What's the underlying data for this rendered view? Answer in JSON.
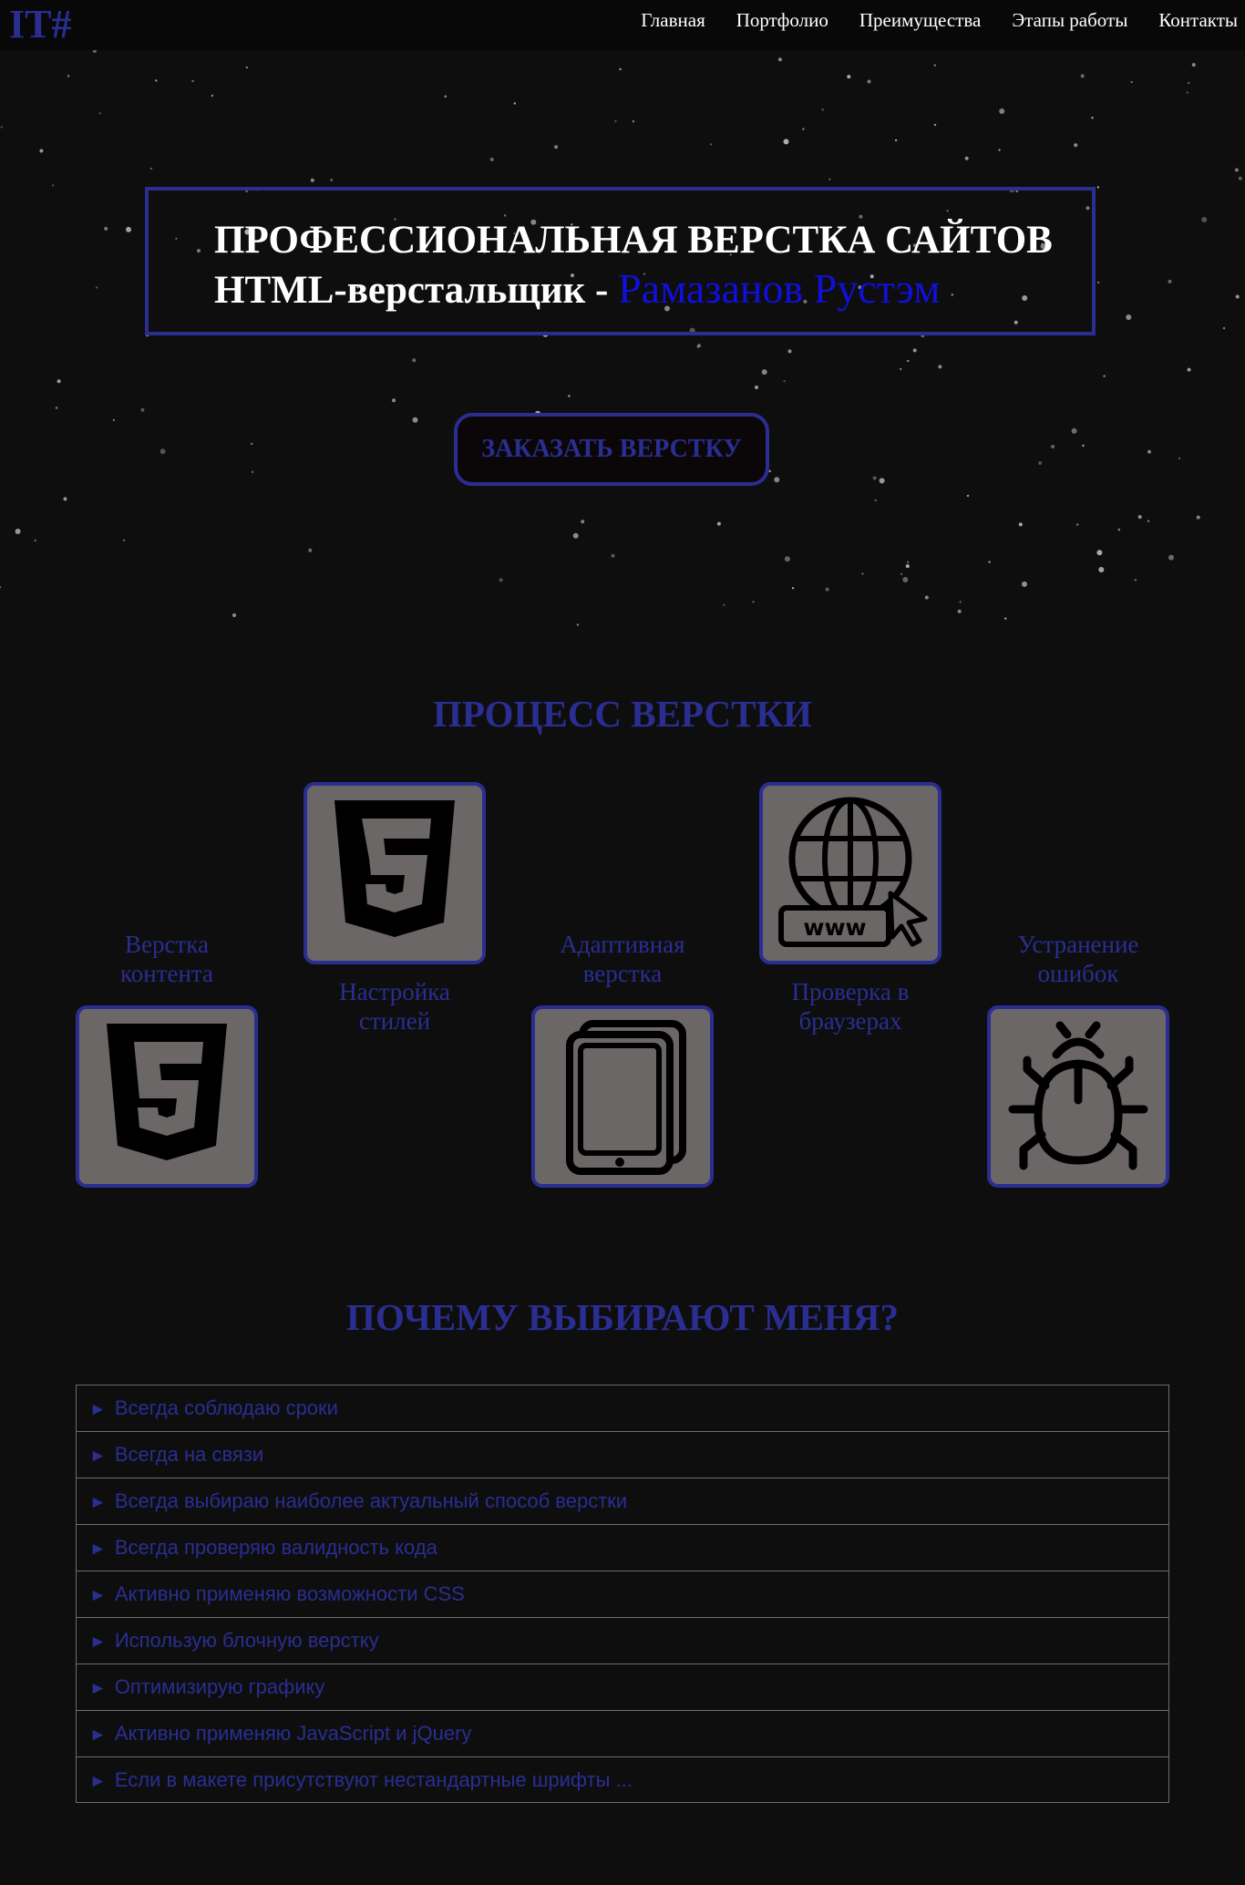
{
  "header": {
    "logo": "IT#",
    "nav": [
      "Главная",
      "Портфолио",
      "Преимущества",
      "Этапы работы",
      "Контакты"
    ]
  },
  "hero": {
    "title_line1": "ПРОФЕССИОНАЛЬНАЯ ВЕРСТКА САЙТОВ",
    "title_line2_prefix": "HTML-верстальщик - ",
    "title_line2_name": "Рамазанов Рустэм",
    "cta_label": "ЗАКАЗАТЬ ВЕРСТКУ"
  },
  "process": {
    "title": "ПРОЦЕСС ВЕРСТКИ",
    "steps": [
      {
        "label": "Верстка контента",
        "icon": "html5-icon"
      },
      {
        "label": "Настройка стилей",
        "icon": "css3-icon"
      },
      {
        "label": "Адаптивная верстка",
        "icon": "tablet-icon"
      },
      {
        "label": "Проверка в браузерах",
        "icon": "globe-www-icon"
      },
      {
        "label": "Устранение ошибок",
        "icon": "bug-icon"
      }
    ]
  },
  "why": {
    "title": "ПОЧЕМУ ВЫБИРАЮТ МЕНЯ?",
    "items": [
      "Всегда соблюдаю сроки",
      "Всегда на связи",
      "Всегда выбираю наиболее актуальный способ верстки",
      "Всегда проверяю валидность кода",
      "Активно применяю возможности CSS",
      "Использую блочную верстку",
      "Оптимизирую графику",
      "Активно применяю JavaScript и jQuery",
      "Если в макете присутствуют нестандартные шрифты ..."
    ],
    "arrow": "►"
  },
  "colors": {
    "accent": "#2a2e91",
    "name": "#1010d8",
    "background": "#0e0e0f",
    "tile": "#6c6767"
  }
}
